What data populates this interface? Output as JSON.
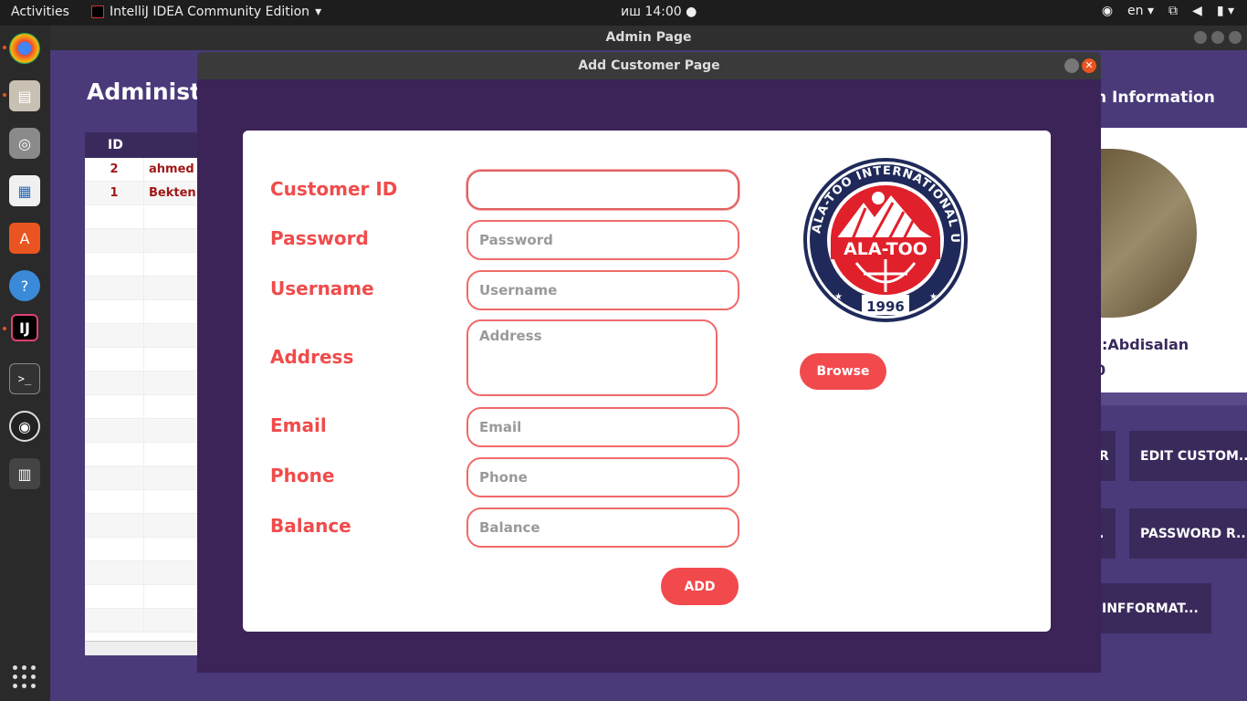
{
  "topbar": {
    "activities": "Activities",
    "app_name": "IntelliJ IDEA Community Edition",
    "clock": "иш 14:00",
    "language": "en"
  },
  "dock": {
    "icons": [
      "chrome-icon",
      "files-icon",
      "rhythmbox-icon",
      "libreoffice-writer-icon",
      "software-center-icon",
      "help-icon",
      "intellij-icon",
      "terminal-icon",
      "obs-icon",
      "video-editor-icon"
    ]
  },
  "admin_window": {
    "title": "Admin Page",
    "heading": "Administ",
    "table": {
      "header": "ID",
      "rows": [
        {
          "id": "2",
          "name": "ahmed"
        },
        {
          "id": "1",
          "name": "Bekten"
        }
      ]
    },
    "info_title": "n Information",
    "user_name": ":Abdisalan",
    "user_id": "0",
    "buttons": {
      "r_btn": "R",
      "edit_customer": "EDIT CUSTOM...",
      "dot_btn": ".",
      "password_reset": "PASSWORD R...",
      "information": "INFFORMAT..."
    }
  },
  "dialog": {
    "title": "Add Customer Page",
    "labels": {
      "customer_id": "Customer ID",
      "password": "Password",
      "username": "Username",
      "address": "Address",
      "email": "Email",
      "phone": "Phone",
      "balance": "Balance"
    },
    "fields": {
      "customer_id": {
        "value": "",
        "placeholder": ""
      },
      "password": {
        "value": "",
        "placeholder": "Password"
      },
      "username": {
        "value": "",
        "placeholder": "Username"
      },
      "address": {
        "value": "",
        "placeholder": "Address"
      },
      "email": {
        "value": "",
        "placeholder": "Email"
      },
      "phone": {
        "value": "",
        "placeholder": "Phone"
      },
      "balance": {
        "value": "",
        "placeholder": "Balance"
      }
    },
    "logo": {
      "ring_text": "ALA-TOO INTERNATIONAL UNIVERSITY",
      "center_text": "ALA-TOO",
      "year": "1996"
    },
    "browse_label": "Browse",
    "add_label": "ADD"
  },
  "colors": {
    "accent": "#f2494d",
    "dialog_bg": "#3c2358",
    "admin_bg": "#4a3a7a",
    "dark_purple": "#3a2a5c"
  }
}
